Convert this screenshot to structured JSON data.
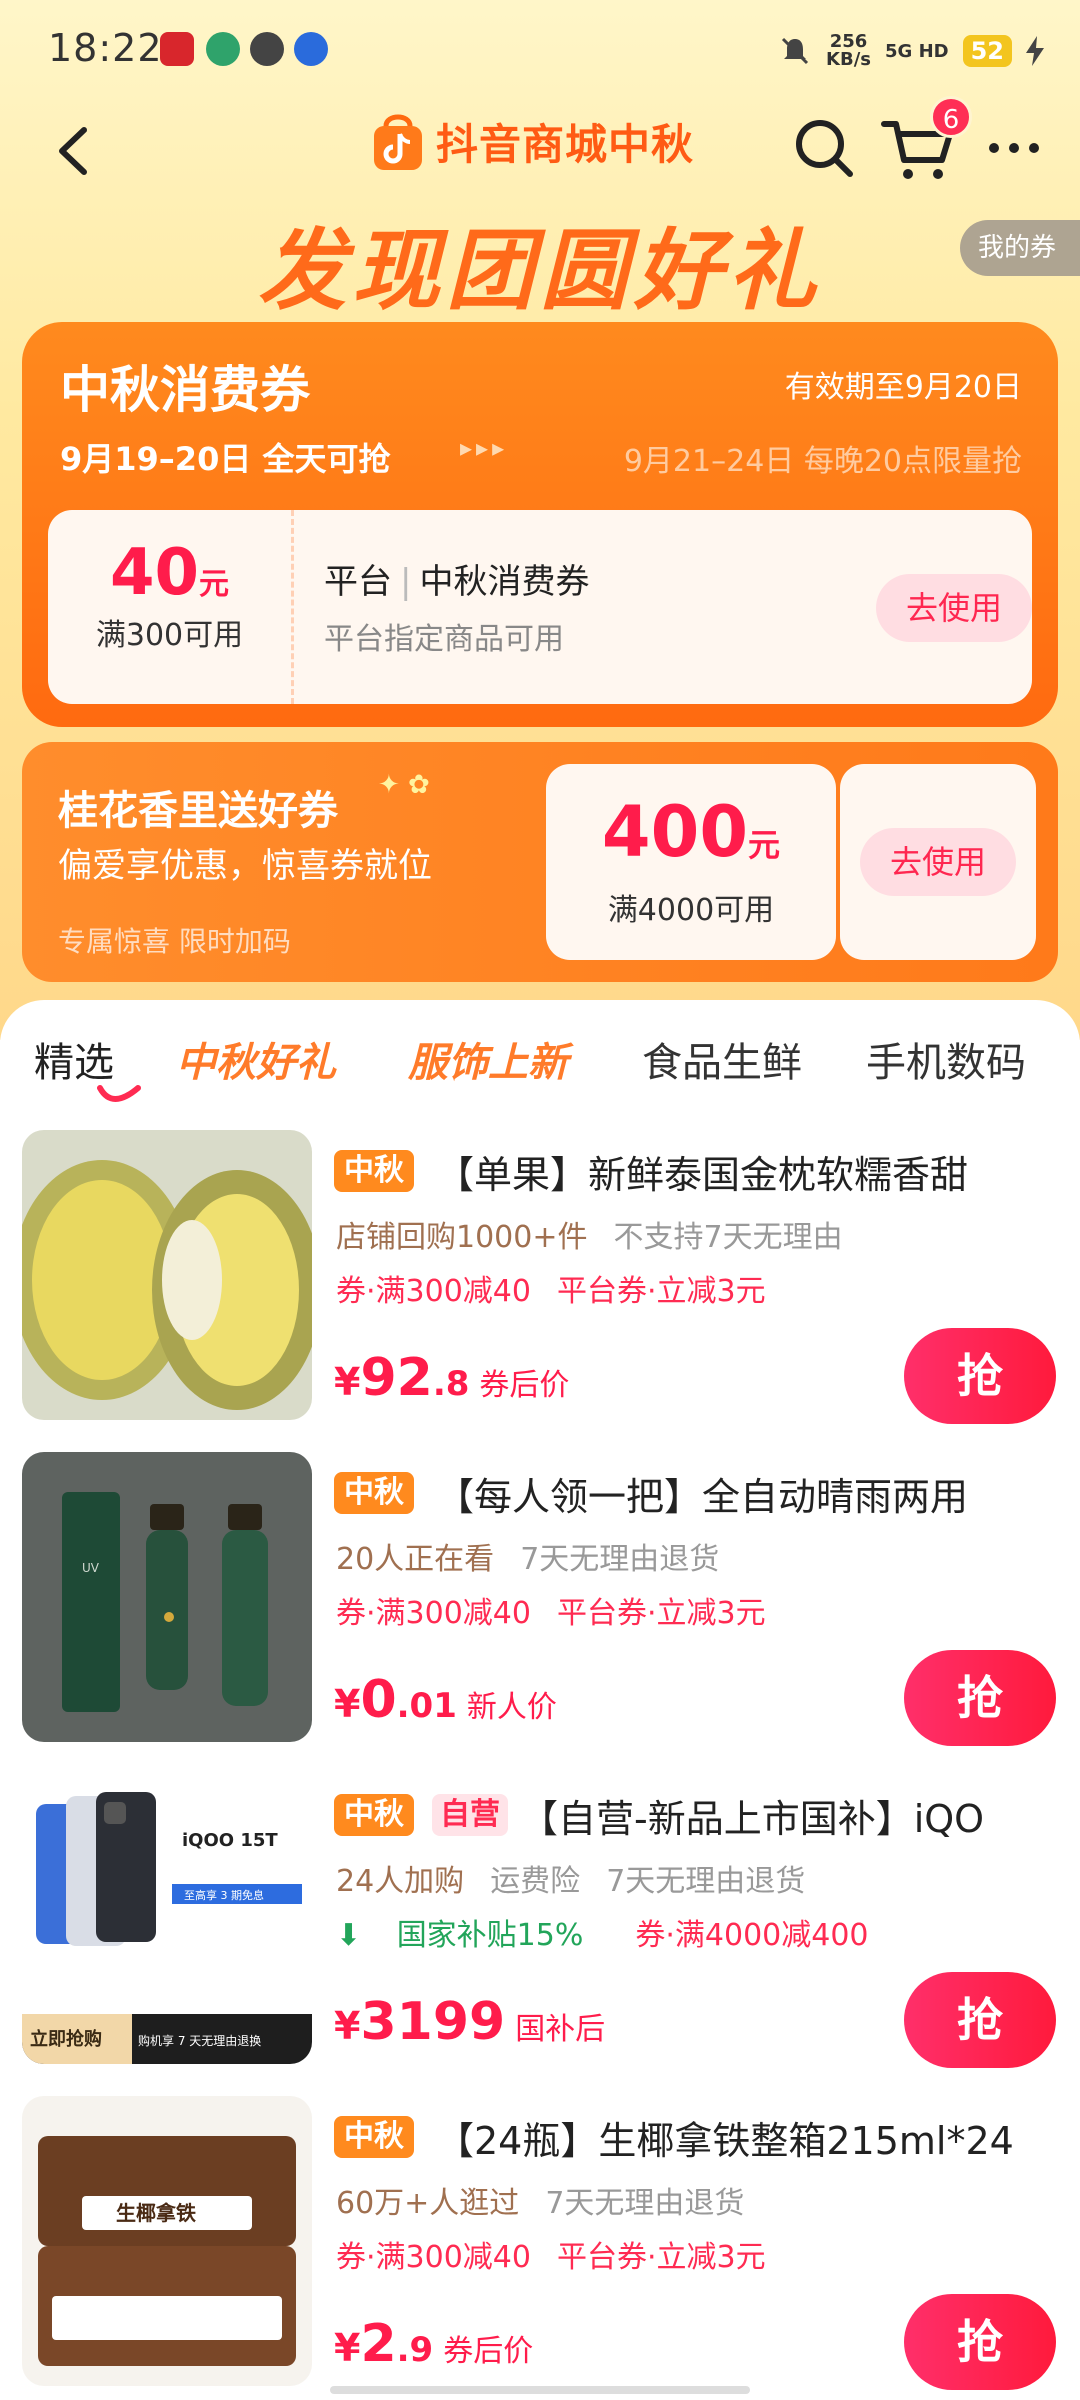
{
  "status_bar": {
    "time": "18:22",
    "net_speed": "256",
    "net_unit": "KB/s",
    "signal": "5G HD",
    "battery": "52"
  },
  "nav": {
    "title": "抖音商城中秋",
    "cart_count": "6"
  },
  "hero": {
    "headline": "发现团圆好礼",
    "my_coupon": "我的券"
  },
  "coupon_panel": {
    "title": "中秋消费券",
    "valid": "有效期至9月20日",
    "round1": "9月19–20日 全天可抢",
    "round2": "9月21–24日 每晚20点限量抢",
    "amount": "40",
    "unit": "元",
    "condition": "满300可用",
    "coupon_title_a": "平台",
    "coupon_title_b": "中秋消费券",
    "coupon_sub": "平台指定商品可用",
    "use": "去使用"
  },
  "osmanthus_panel": {
    "title": "桂花香里送好券",
    "subtitle": "偏爱享优惠，惊喜券就位",
    "tag": "专属惊喜 限时加码",
    "amount": "400",
    "unit": "元",
    "condition": "满4000可用",
    "use": "去使用"
  },
  "tabs": [
    "精选",
    "中秋好礼",
    "服饰上新",
    "食品生鲜",
    "手机数码"
  ],
  "products": [
    {
      "tag": "中秋",
      "title": "【单果】新鲜泰国金枕软糯香甜",
      "meta1": "店铺回购1000+件",
      "meta2": "不支持7天无理由",
      "promo1": "券·满300减40",
      "promo2": "平台券·立减3元",
      "cur": "¥",
      "price_int": "92",
      "price_dec": ".8",
      "price_note": "券后价",
      "cta": "抢"
    },
    {
      "tag": "中秋",
      "title": "【每人领一把】全自动晴雨两用",
      "meta1": "20人正在看",
      "meta2": "7天无理由退货",
      "promo1": "券·满300减40",
      "promo2": "平台券·立减3元",
      "cur": "¥",
      "price_int": "0",
      "price_dec": ".01",
      "price_note": "新人价",
      "cta": "抢"
    },
    {
      "tag": "中秋",
      "tag2": "自营",
      "title": "【自营-新品上市国补】iQO",
      "meta1": "24人加购",
      "meta2": "运费险",
      "meta3": "7天无理由退货",
      "promo1": "国家补贴15%",
      "promo2": "券·满4000减400",
      "cur": "¥",
      "price_int": "3199",
      "price_dec": "",
      "price_note": "国补后",
      "cta": "抢",
      "img_text": {
        "brand": "iQOO 15T",
        "line1": "至高享 3 期免息",
        "badge": "立即抢购",
        "badge2": "购机享 7 天无理由退换"
      }
    },
    {
      "tag": "中秋",
      "title": "【24瓶】生椰拿铁整箱215ml*24",
      "meta1": "60万+人逛过",
      "meta2": "7天无理由退货",
      "promo1": "券·满300减40",
      "promo2": "平台券·立减3元",
      "cur": "¥",
      "price_int": "2",
      "price_dec": ".9",
      "price_note": "券后价",
      "cta": "抢",
      "img_text": {
        "label": "生椰拿铁"
      }
    }
  ],
  "colors": {
    "brand_orange": "#ff6a10",
    "price_red": "#ff1c4b",
    "cta_pink": "#ff2f6a"
  }
}
